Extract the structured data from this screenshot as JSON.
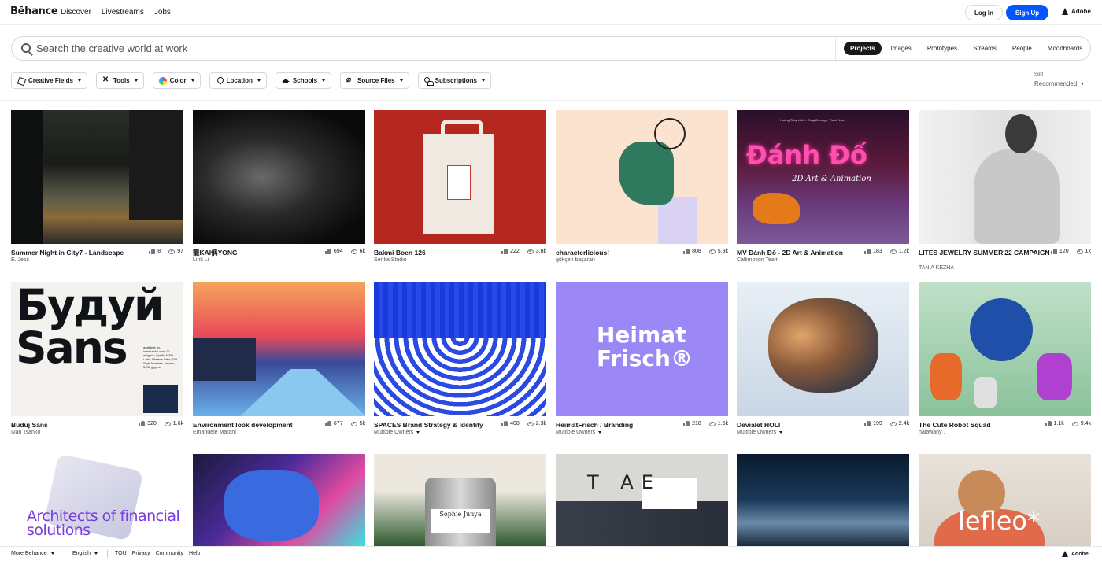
{
  "nav": {
    "logo": "Bēhance",
    "links": [
      "Discover",
      "Livestreams",
      "Jobs"
    ],
    "login": "Log In",
    "signup": "Sign Up",
    "brand": "Adobe"
  },
  "search": {
    "placeholder": "Search the creative world at work",
    "segments": [
      "Projects",
      "Images",
      "Prototypes",
      "Streams",
      "People",
      "Moodboards"
    ],
    "active_segment": "Projects"
  },
  "filters": [
    "Creative Fields",
    "Tools",
    "Color",
    "Location",
    "Schools",
    "Source Files",
    "Subscriptions"
  ],
  "sort": {
    "label": "Sort",
    "value": "Recommended"
  },
  "projects": [
    {
      "title": "Summer Night in City7 - Landscape",
      "owner": "E. Jess",
      "likes": "8",
      "views": "97"
    },
    {
      "title": "籠KAI偁YONG",
      "owner": "Link Li",
      "likes": "694",
      "views": "6k"
    },
    {
      "title": "Bakmi Boen 126",
      "owner": "Senka Studio",
      "likes": "222",
      "views": "3.8k"
    },
    {
      "title": "characterlicious!",
      "owner": "gökçen başaran",
      "likes": "808",
      "views": "5.9k"
    },
    {
      "title": "MV Đánh Đố - 2D Art & Animation",
      "owner": "Callimotion Team",
      "likes": "183",
      "views": "1.2k",
      "art_title": "Đánh Đố",
      "art_subtitle": "2D Art & Animation",
      "art_credits": "Hoàng Thùy Linh × Tùng Dương × Thanh Lam"
    },
    {
      "title": "LITES JEWELRY SUMMER'22 CAMPAIGN",
      "owner": "TANIA KEZHA",
      "likes": "120",
      "views": "1k"
    },
    {
      "title": "Buduj Sans",
      "owner": "Ivan Tsanko",
      "likes": "320",
      "views": "1.6k",
      "art_title": "Будуй Sans",
      "art_text": "available on ivantsanko.com 10 weights; Cyrillic & EU Latin; Ukraine Latin; Old Style Number; Arrows; 5930 glyphs;"
    },
    {
      "title": "Environment look development",
      "owner": "Emanuele Marani",
      "likes": "677",
      "views": "5k"
    },
    {
      "title": "SPACES Brand Strategy & Identity",
      "owner": "Multiple Owners",
      "likes": "408",
      "views": "2.3k"
    },
    {
      "title": "HeimatFrisch / Branding",
      "owner": "Multiple Owners",
      "likes": "218",
      "views": "1.5k",
      "art_title": "Heimat Frisch®"
    },
    {
      "title": "Devialet HOLI",
      "owner": "Multiple Owners",
      "likes": "199",
      "views": "2.4k"
    },
    {
      "title": "The Cute Robot Squad",
      "owner": "halawany .",
      "likes": "1.1k",
      "views": "9.4k"
    }
  ],
  "row3_art": [
    "Architects of financial solutions",
    "",
    "Sophie Junya",
    "T AE",
    "",
    "lefleo*"
  ],
  "footer": {
    "more": "More Behance",
    "lang": "English",
    "links": [
      "TOU",
      "Privacy",
      "Community",
      "Help"
    ],
    "brand": "Adobe"
  }
}
